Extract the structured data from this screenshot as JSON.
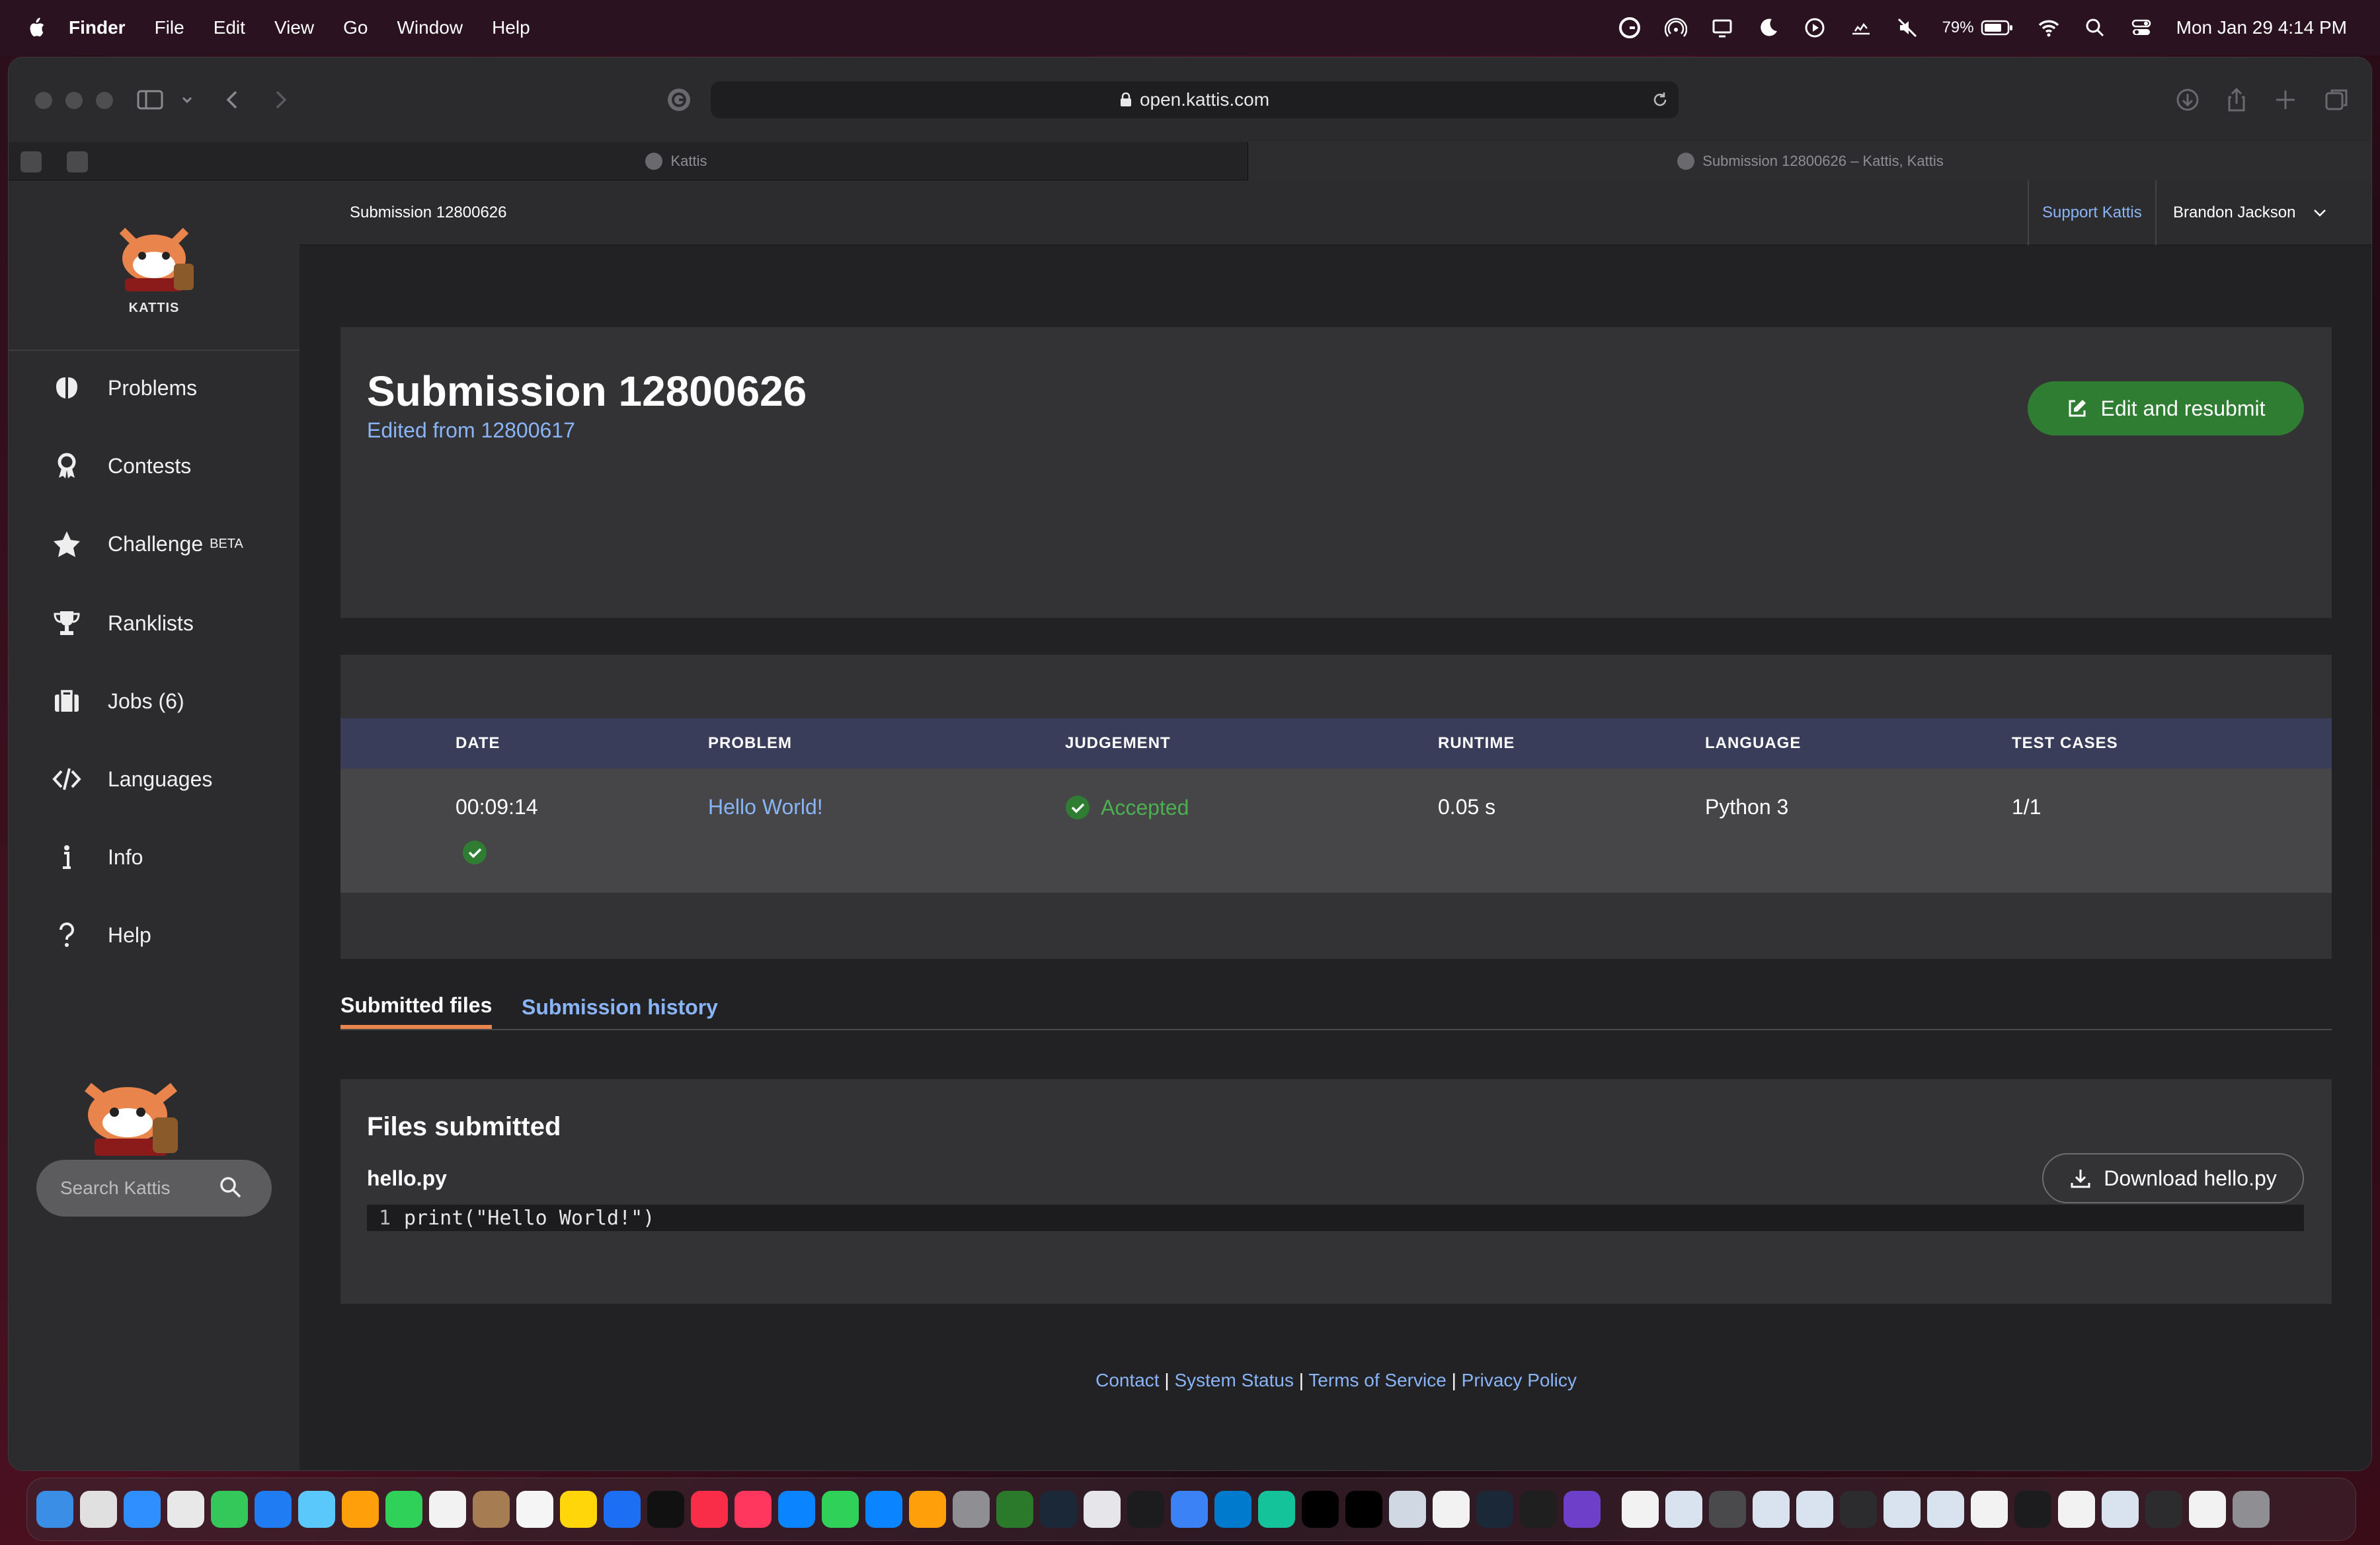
{
  "menubar": {
    "items": [
      "Finder",
      "File",
      "Edit",
      "View",
      "Go",
      "Window",
      "Help"
    ],
    "battery": "79%",
    "datetime": "Mon Jan 29  4:14 PM"
  },
  "browser": {
    "url": "open.kattis.com",
    "tabs": [
      "Kattis",
      "Submission 12800626 – Kattis, Kattis"
    ]
  },
  "sidebar": {
    "logo_text": "KATTIS",
    "items": [
      {
        "label": "Problems",
        "icon": "brain-icon"
      },
      {
        "label": "Contests",
        "icon": "award-icon"
      },
      {
        "label": "Challenge",
        "icon": "star-icon",
        "badge": "BETA"
      },
      {
        "label": "Ranklists",
        "icon": "trophy-icon"
      },
      {
        "label": "Jobs (6)",
        "icon": "briefcase-icon"
      },
      {
        "label": "Languages",
        "icon": "code-icon"
      },
      {
        "label": "Info",
        "icon": "info-icon"
      },
      {
        "label": "Help",
        "icon": "question-icon"
      }
    ],
    "search_placeholder": "Search Kattis"
  },
  "topbar": {
    "breadcrumb": "Submission 12800626",
    "support": "Support Kattis",
    "user": "Brandon Jackson"
  },
  "submission": {
    "title": "Submission 12800626",
    "edited_from": "Edited from 12800617",
    "resubmit_label": "Edit and resubmit"
  },
  "table": {
    "headers": [
      "DATE",
      "PROBLEM",
      "JUDGEMENT",
      "RUNTIME",
      "LANGUAGE",
      "TEST CASES"
    ],
    "row": {
      "date": "00:09:14",
      "problem": "Hello World!",
      "judgement": "Accepted",
      "runtime": "0.05 s",
      "language": "Python 3",
      "test_cases": "1/1"
    }
  },
  "tabs": [
    "Submitted files",
    "Submission history"
  ],
  "files": {
    "title": "Files submitted",
    "filename": "hello.py",
    "download_label": "Download hello.py",
    "line_number": "1",
    "code": "print(\"Hello World!\")"
  },
  "footer": {
    "links": [
      "Contact",
      "System Status",
      "Terms of Service",
      "Privacy Policy"
    ],
    "separator": "|"
  },
  "colors": {
    "accent_link": "#8ab4f8",
    "success": "#2e7d32",
    "tab_underline": "#e8844c",
    "table_header": "#3a3d5a"
  }
}
